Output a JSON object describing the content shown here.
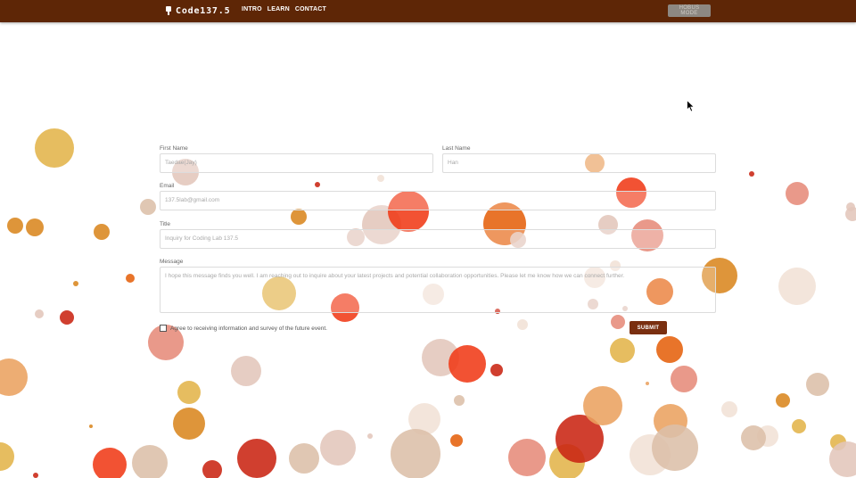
{
  "topbar": {
    "brand": "Code137.5",
    "brand_icon": "flask-icon",
    "nav": [
      {
        "label": "INTRO"
      },
      {
        "label": "LEARN"
      },
      {
        "label": "CONTACT"
      }
    ],
    "mode_button": "HOBUS MODE"
  },
  "form": {
    "first_name": {
      "label": "First Name",
      "value": "Taedae(Jay)"
    },
    "last_name": {
      "label": "Last Name",
      "value": "Han"
    },
    "email": {
      "label": "Email",
      "value": "137.5lab@gmail.com"
    },
    "title": {
      "label": "Title",
      "value": "Inquiry for Coding Lab 137.5"
    },
    "message": {
      "label": "Message",
      "value": "I hope this message finds you well. I am reaching out to inquire about your latest projects and potential collaboration opportunities. Please let me know how we can connect further."
    },
    "consent": "Agree to receiving information and survey of the future event.",
    "submit": "SUBMIT"
  },
  "colors": {
    "topbar": "#5e2606",
    "submit": "#7a2f10",
    "bubbles": [
      "#e2b44a",
      "#d9861f",
      "#f03a17",
      "#e5610d",
      "#e3c6bb",
      "#dcbfa9",
      "#c92412",
      "#e68b7a",
      "#f1e1d6",
      "#eaa260"
    ]
  }
}
